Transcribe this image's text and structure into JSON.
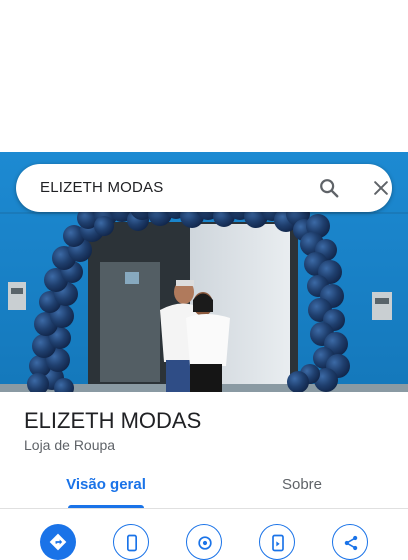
{
  "search": {
    "query": "ELIZETH MODAS",
    "search_icon": "search-icon",
    "close_icon": "close-icon"
  },
  "place": {
    "name": "ELIZETH MODAS",
    "category": "Loja de Roupa"
  },
  "tabs": [
    {
      "label": "Visão geral",
      "selected": true
    },
    {
      "label": "Sobre",
      "selected": false
    }
  ],
  "actions": [
    {
      "icon": "directions-icon"
    },
    {
      "icon": "phone-icon"
    },
    {
      "icon": "location-icon"
    },
    {
      "icon": "send-to-phone-icon"
    },
    {
      "icon": "share-icon"
    }
  ],
  "colors": {
    "accent": "#1a73e8",
    "wall": "#1f89cf",
    "balloons": "#1c3f6e"
  }
}
